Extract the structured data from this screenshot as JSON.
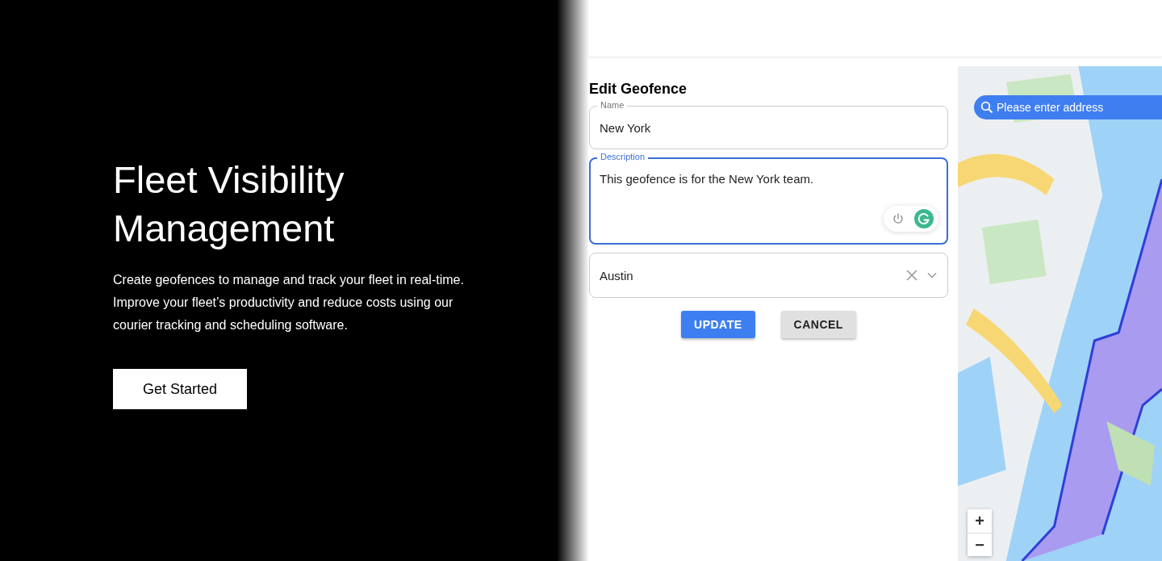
{
  "hero": {
    "title": "Fleet Visibility Management",
    "description": "Create geofences to manage and track your fleet in real-time. Improve your fleet’s productivity and reduce costs using our courier tracking and scheduling software.",
    "button": "Get Started"
  },
  "form": {
    "title": "Edit Geofence",
    "fields": [
      {
        "kind": "text",
        "label": "Name",
        "value": "New York",
        "focused": false
      },
      {
        "kind": "textarea",
        "label": "Description",
        "value": "This geofence is for the New York team.",
        "focused": true
      },
      {
        "kind": "select",
        "value": "Austin",
        "focused": false
      }
    ],
    "buttons": [
      {
        "label": "UPDATE",
        "primary": true
      },
      {
        "label": "CANCEL",
        "primary": false
      }
    ]
  },
  "map": {
    "search": {
      "placeholder": "Please enter address"
    },
    "zoom_in": "+",
    "zoom_out": "−"
  }
}
